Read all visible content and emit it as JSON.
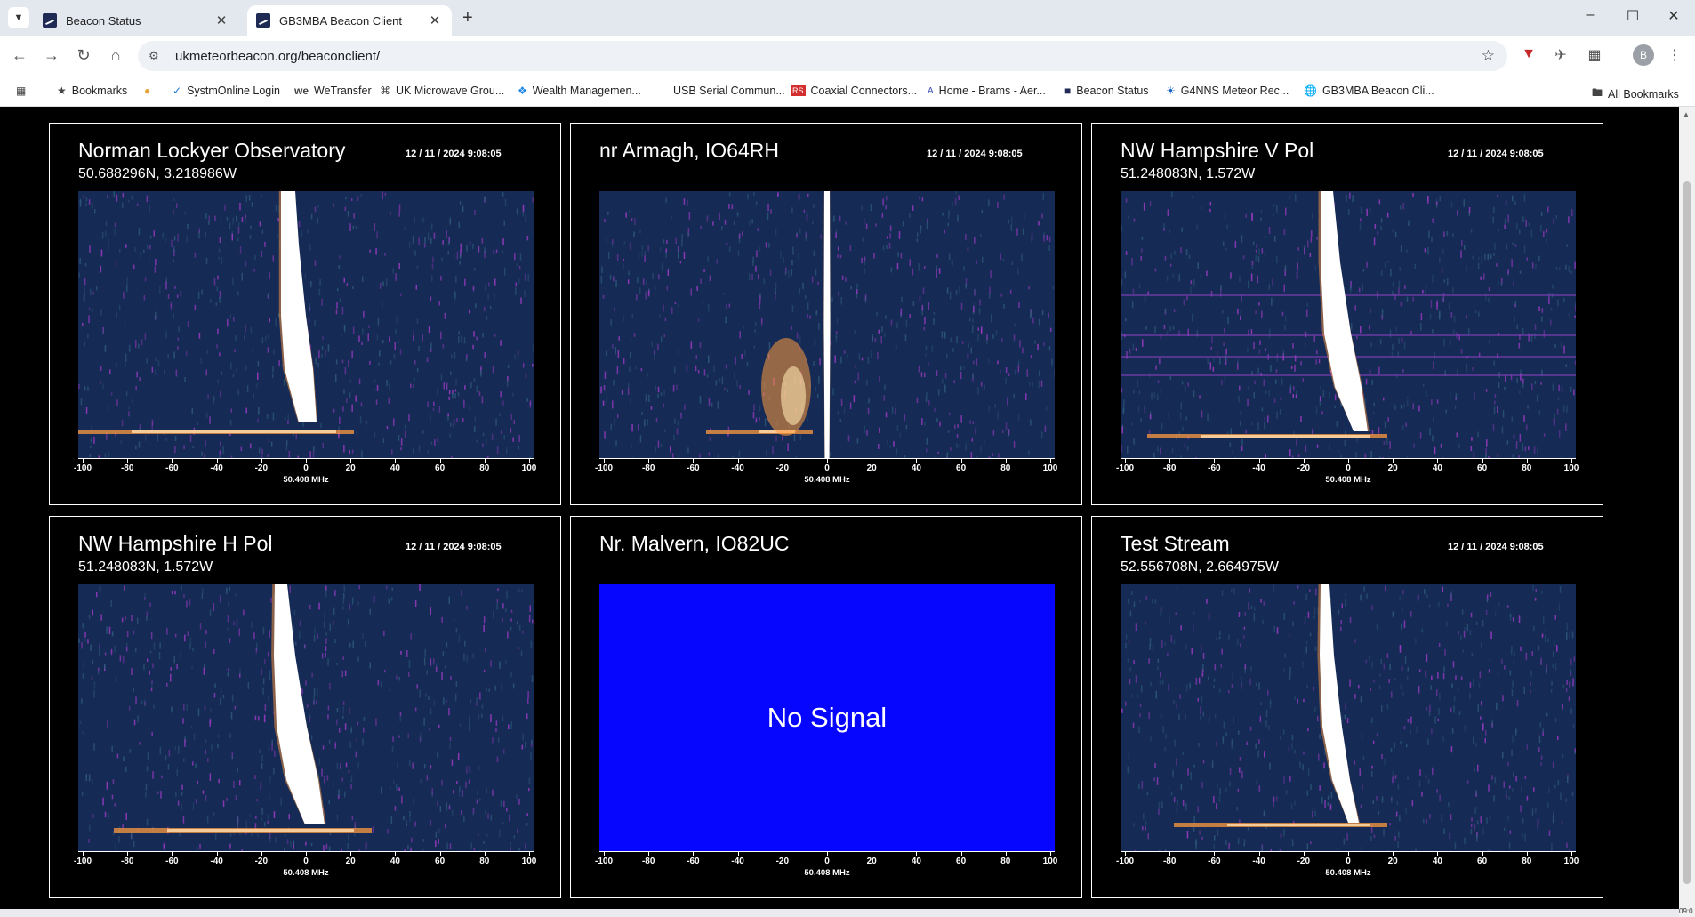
{
  "browser": {
    "tabs": [
      {
        "title": "Beacon Status",
        "active": false
      },
      {
        "title": "GB3MBA Beacon Client",
        "active": true
      }
    ],
    "url": "ukmeteorbeacon.org/beaconclient/",
    "avatar_initial": "B",
    "bookmarks": [
      {
        "label": "Bookmarks",
        "icon": "star-icon"
      },
      {
        "label": "",
        "icon": "chrome-icon"
      },
      {
        "label": "SystmOnline Login",
        "icon": "systmonline-icon"
      },
      {
        "label": "WeTransfer",
        "icon": "wetransfer-icon"
      },
      {
        "label": "UK Microwave Grou...",
        "icon": "microwave-icon"
      },
      {
        "label": "Wealth Managemen...",
        "icon": "wealth-icon"
      },
      {
        "label": "USB Serial Commun...",
        "icon": ""
      },
      {
        "label": "Coaxial Connectors...",
        "icon": "rs-icon"
      },
      {
        "label": "Home - Brams - Aer...",
        "icon": "brams-icon"
      },
      {
        "label": "Beacon Status",
        "icon": "beacon-icon"
      },
      {
        "label": "G4NNS Meteor Rec...",
        "icon": "g4nns-icon"
      },
      {
        "label": "GB3MBA Beacon Cli...",
        "icon": "globe-icon"
      }
    ],
    "all_bookmarks": "All Bookmarks"
  },
  "axis": {
    "ticks": [
      "-100",
      "-80",
      "-60",
      "-40",
      "-20",
      "0",
      "20",
      "40",
      "60",
      "80",
      "100"
    ],
    "label": "50.408 MHz"
  },
  "panels": [
    {
      "id": "norman",
      "title": "Norman Lockyer Observatory",
      "coords": "50.688296N, 3.218986W",
      "time": "12 / 11 / 2024  9:08:05",
      "signal": true
    },
    {
      "id": "armagh",
      "title": "nr Armagh, IO64RH",
      "coords": "",
      "time": "12 / 11 / 2024  9:08:05",
      "signal": true
    },
    {
      "id": "nwv",
      "title": "NW Hampshire V Pol",
      "coords": "51.248083N, 1.572W",
      "time": "12 / 11 / 2024  9:08:05",
      "signal": true
    },
    {
      "id": "nwh",
      "title": "NW Hampshire H Pol",
      "coords": "51.248083N, 1.572W",
      "time": "12 / 11 / 2024  9:08:05",
      "signal": true
    },
    {
      "id": "malvern",
      "title": "Nr. Malvern, IO82UC",
      "coords": "",
      "time": "",
      "signal": false,
      "message": "No Signal"
    },
    {
      "id": "test",
      "title": "Test Stream",
      "coords": "52.556708N, 2.664975W",
      "time": "12 / 11 / 2024  9:08:05",
      "signal": true
    }
  ],
  "colors": {
    "spectrogram_bg": "#162a56",
    "no_signal_bg": "#0606ff",
    "trace_hot": "#ffffff",
    "trace_warm": "#ff9a3c",
    "noise": "#a23cc8"
  },
  "taskbar_clock": "09:0"
}
